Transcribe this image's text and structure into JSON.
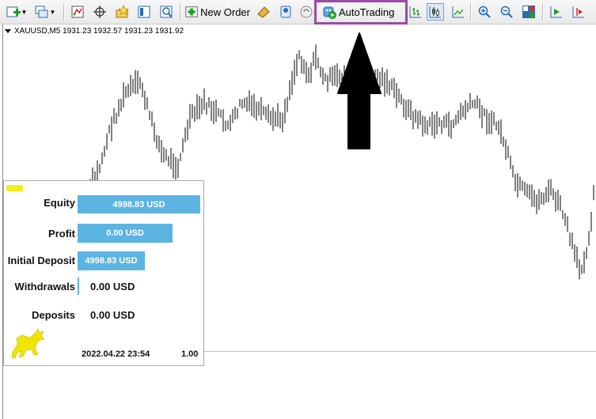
{
  "toolbar": {
    "new_order_label": "New Order",
    "autotrading_label": "AutoTrading",
    "icons": [
      "new-chart-icon",
      "profiles-icon",
      "market-watch-icon",
      "crosshair-icon",
      "favorites-icon",
      "navigator-icon",
      "strategy-tester-icon",
      "new-order-icon",
      "metaeditor-icon",
      "signals-icon",
      "autotrading-icon",
      "bar-chart-icon",
      "candlestick-icon",
      "line-chart-icon",
      "zoom-in-icon",
      "zoom-out-icon",
      "tile-windows-icon",
      "chart-shift-icon",
      "auto-scroll-icon"
    ],
    "highlight_color": "#9b4aa8"
  },
  "chart": {
    "symbol_info": "XAUUSD,M5  1931.23 1932.57 1931.23 1931.92",
    "colors": {
      "bars": "#000000",
      "background": "#ffffff",
      "arrow": "#000000"
    }
  },
  "panel": {
    "rows": [
      {
        "label": "Equity",
        "value": "4998.83 USD"
      },
      {
        "label": "Profit",
        "value": "0.00 USD"
      },
      {
        "label": "Initial Deposit",
        "value": "4998.83 USD"
      },
      {
        "label": "Withdrawals",
        "value": "0.00 USD"
      },
      {
        "label": "Deposits",
        "value": "0.00 USD"
      }
    ],
    "date": "2022.04.22 23:54",
    "version": "1.00",
    "colors": {
      "bar": "#5cb4e3",
      "tag": "#f4ee18",
      "logo": "#f1e400"
    }
  }
}
